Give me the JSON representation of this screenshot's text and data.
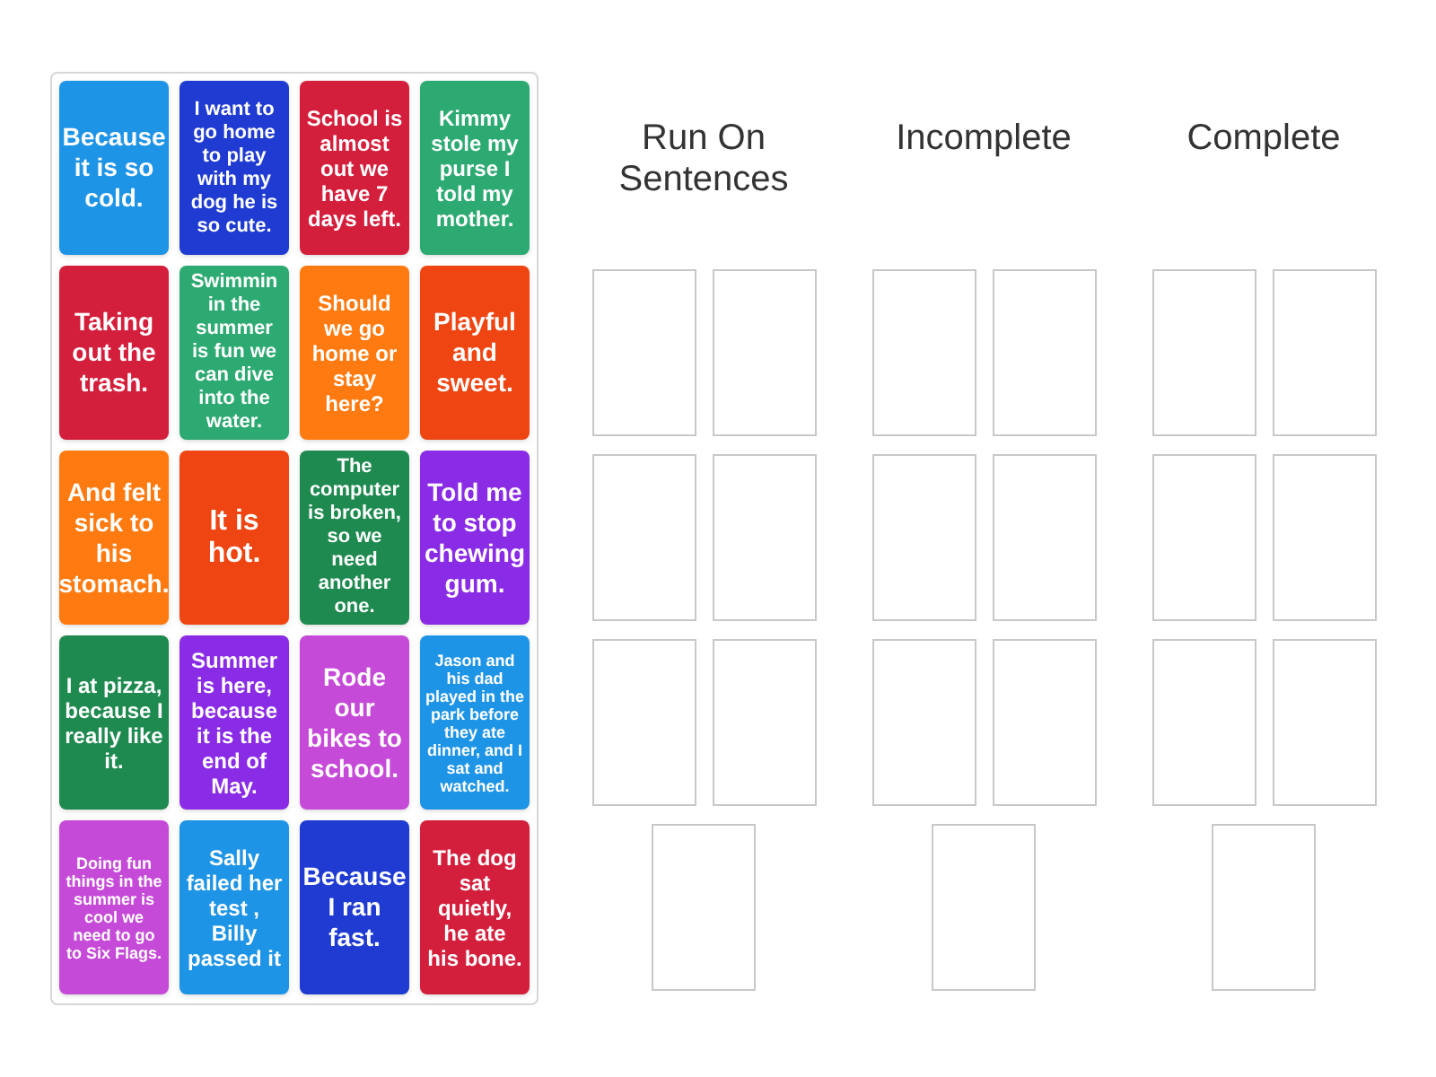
{
  "cards": [
    {
      "text": "Because it is so cold.",
      "color": "#1e94e6"
    },
    {
      "text": "I want to go home to play with my dog he is so cute.",
      "color": "#1f3bd1"
    },
    {
      "text": "School is almost out we have 7 days left.",
      "color": "#d41f3c"
    },
    {
      "text": "Kimmy stole my purse I told my mother.",
      "color": "#2daa72"
    },
    {
      "text": "Taking out the trash.",
      "color": "#d41f3c"
    },
    {
      "text": "Swimmin in the summer is fun we can dive into the water.",
      "color": "#2daa72"
    },
    {
      "text": "Should we go home or stay here?",
      "color": "#ff7a10"
    },
    {
      "text": "Playful and sweet.",
      "color": "#ee4512"
    },
    {
      "text": "And felt sick to his stomach.",
      "color": "#ff7a10"
    },
    {
      "text": "It is hot.",
      "color": "#ee4512"
    },
    {
      "text": "The computer is broken, so we need another one.",
      "color": "#1e8a50"
    },
    {
      "text": "Told me to stop chewing gum.",
      "color": "#8a2be6"
    },
    {
      "text": "I at pizza, because I really like it.",
      "color": "#1e8a50"
    },
    {
      "text": "Summer is here, because it is the end of May.",
      "color": "#8a2be6"
    },
    {
      "text": "Rode our bikes to school.",
      "color": "#c64ad8"
    },
    {
      "text": "Jason and his dad played in the park before they ate dinner, and I sat and watched.",
      "color": "#1e94e6"
    },
    {
      "text": "Doing fun things in the summer is cool we need to go to Six Flags.",
      "color": "#c64ad8"
    },
    {
      "text": "Sally failed her test , Billy passed it",
      "color": "#1e94e6"
    },
    {
      "text": "Because I ran fast.",
      "color": "#1f3bd1"
    },
    {
      "text": "The dog sat quietly, he ate his bone.",
      "color": "#d41f3c"
    }
  ],
  "groups": [
    {
      "title": "Run On Sentences"
    },
    {
      "title": "Incomplete"
    },
    {
      "title": "Complete"
    }
  ]
}
